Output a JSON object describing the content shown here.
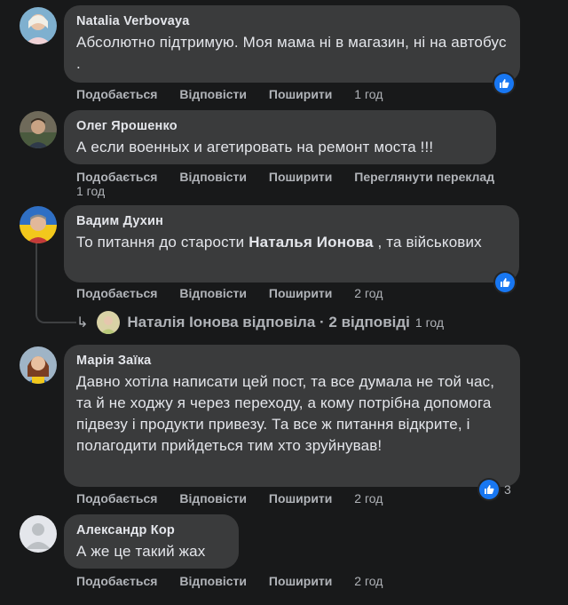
{
  "comments": [
    {
      "author": "Natalia Verbovaya",
      "text": "Абсолютно підтримую. Моя мама ні в магазин, ні на автобус .",
      "actions": [
        "Подобається",
        "Відповісти",
        "Поширити"
      ],
      "time": "1 год",
      "reactions": {
        "icon": "like-icon"
      }
    },
    {
      "author": "Олег Ярошенко",
      "text": "А если военных и агетировать на ремонт моста !!!",
      "actions": [
        "Подобається",
        "Відповісти",
        "Поширити",
        "Переглянути переклад"
      ],
      "time": "1 год"
    },
    {
      "author": "Вадим Духин",
      "text_before": "То питання до старости ",
      "text_mention": "Наталья Ионова",
      "text_after": " , та військових",
      "actions": [
        "Подобається",
        "Відповісти",
        "Поширити"
      ],
      "time": "2 год",
      "reactions": {
        "icon": "like-icon"
      },
      "replies_summary": {
        "text": "Наталія Іонова відповіла · 2 відповіді",
        "time": "1 год"
      }
    },
    {
      "author": "Марія Заїка",
      "text": "Давно хотіла написати цей пост, та все думала не той час, та й не ходжу я через переходу, а кому потрібна допомога підвезу і продукти привезу. Та все ж питання відкрите, і полагодити прийдеться тим хто зруйнував!",
      "actions": [
        "Подобається",
        "Відповісти",
        "Поширити"
      ],
      "time": "2 год",
      "reactions": {
        "icon": "like-icon",
        "count": "3"
      }
    },
    {
      "author": "Александр Кор",
      "text": "А же це такий жах",
      "actions": [
        "Подобається",
        "Відповісти",
        "Поширити"
      ],
      "time": "2 год"
    }
  ],
  "colors": {
    "background": "#18191a",
    "bubble": "#3a3b3c",
    "text": "#e4e6eb",
    "secondary": "#b0b3b8",
    "like": "#1877f2"
  }
}
